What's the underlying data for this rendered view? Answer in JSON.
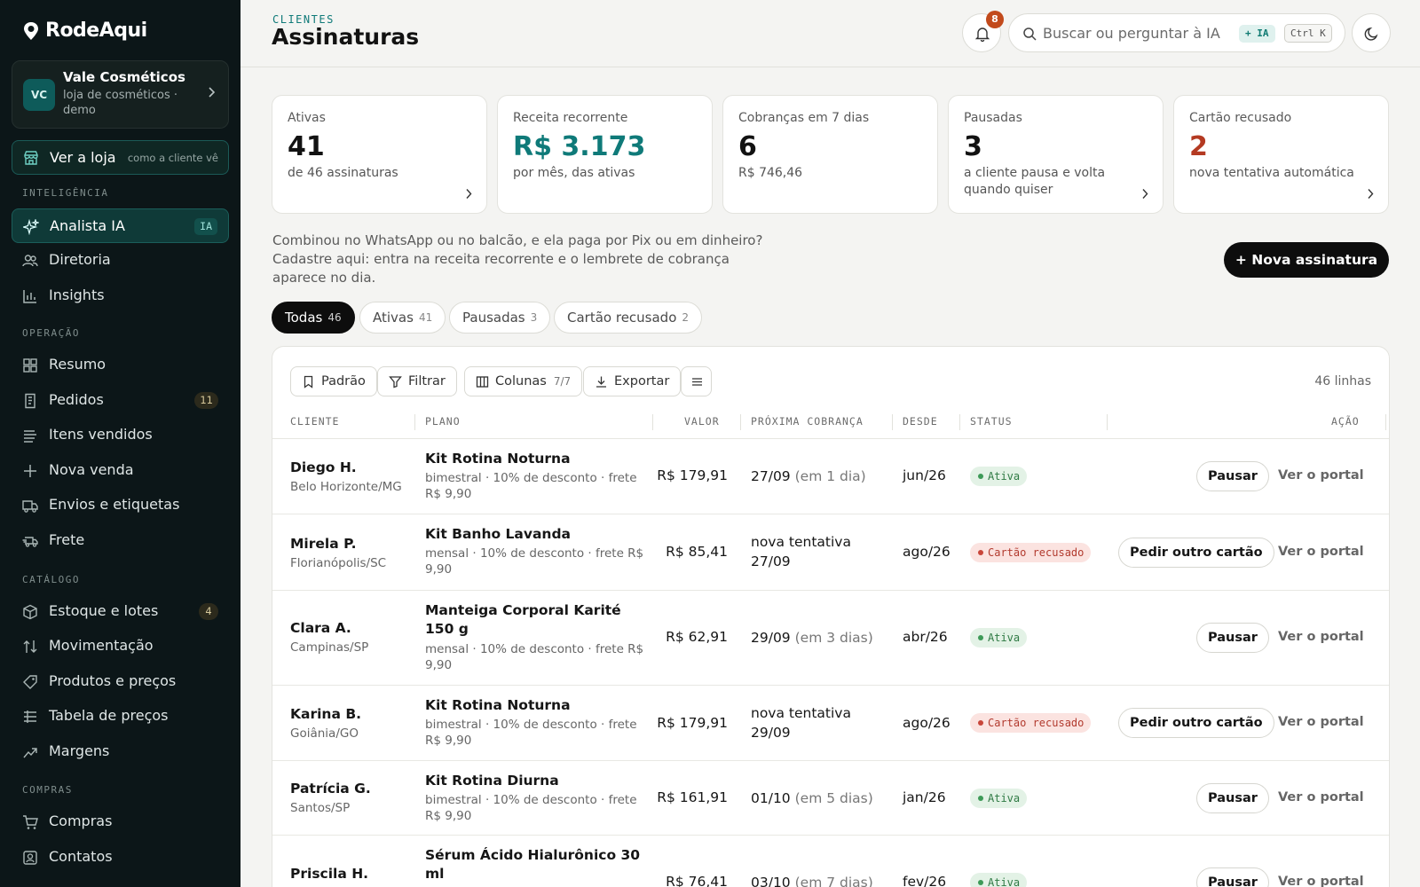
{
  "app": {
    "name": "RodeAqui"
  },
  "store": {
    "initials": "VC",
    "name": "Vale Cosméticos",
    "subtitle": "loja de cosméticos · demo"
  },
  "see_store": {
    "label": "Ver a loja",
    "hint": "como a cliente vê"
  },
  "sidebar": {
    "sections": [
      {
        "label": "INTELIGÊNCIA"
      },
      {
        "label": "OPERAÇÃO"
      },
      {
        "label": "CATÁLOGO"
      },
      {
        "label": "COMPRAS"
      }
    ],
    "items": [
      {
        "label": "Analista IA",
        "badge": "IA",
        "icon": "sparkle-icon"
      },
      {
        "label": "Diretoria",
        "icon": "users-icon"
      },
      {
        "label": "Insights",
        "icon": "bar-chart-icon"
      },
      {
        "label": "Resumo",
        "icon": "grid-icon"
      },
      {
        "label": "Pedidos",
        "badge": "11",
        "icon": "receipt-icon"
      },
      {
        "label": "Itens vendidos",
        "icon": "list-icon"
      },
      {
        "label": "Nova venda",
        "icon": "plus-icon"
      },
      {
        "label": "Envios e etiquetas",
        "icon": "truck-icon"
      },
      {
        "label": "Frete",
        "icon": "delivery-icon"
      },
      {
        "label": "Estoque e lotes",
        "badge": "4",
        "icon": "box-icon"
      },
      {
        "label": "Movimentação",
        "icon": "arrows-updown-icon"
      },
      {
        "label": "Produtos e preços",
        "icon": "tag-icon"
      },
      {
        "label": "Tabela de preços",
        "icon": "table-icon"
      },
      {
        "label": "Margens",
        "icon": "trend-up-icon"
      },
      {
        "label": "Compras",
        "icon": "cart-icon"
      },
      {
        "label": "Contatos",
        "icon": "contact-icon"
      }
    ]
  },
  "header": {
    "breadcrumb": "CLIENTES",
    "title": "Assinaturas",
    "notifications": "8",
    "search_placeholder": "Buscar ou perguntar à IA",
    "ia_chip": "+ IA",
    "shortcut": "Ctrl K"
  },
  "stats": [
    {
      "label": "Ativas",
      "value": "41",
      "sub": "de 46 assinaturas"
    },
    {
      "label": "Receita recorrente",
      "value": "R$ 3.173",
      "sub": "por mês, das ativas"
    },
    {
      "label": "Cobranças em 7 dias",
      "value": "6",
      "sub": "R$ 746,46"
    },
    {
      "label": "Pausadas",
      "value": "3",
      "sub": "a cliente pausa e volta quando quiser"
    },
    {
      "label": "Cartão recusado",
      "value": "2",
      "sub": "nova tentativa automática"
    }
  ],
  "intro": "Combinou no WhatsApp ou no balcão, e ela paga por Pix ou em dinheiro? Cadastre aqui: entra na receita recorrente e o lembrete de cobrança aparece no dia.",
  "new_button": "+ Nova assinatura",
  "tabs": [
    {
      "label": "Todas",
      "count": "46"
    },
    {
      "label": "Ativas",
      "count": "41"
    },
    {
      "label": "Pausadas",
      "count": "3"
    },
    {
      "label": "Cartão recusado",
      "count": "2"
    }
  ],
  "toolbar": {
    "preset": "Padrão",
    "filter": "Filtrar",
    "columns": "Colunas",
    "columns_count": "7/7",
    "export": "Exportar",
    "rows": "46 linhas"
  },
  "columns": [
    "CLIENTE",
    "PLANO",
    "VALOR",
    "PRÓXIMA COBRANÇA",
    "DESDE",
    "STATUS",
    "AÇÃO"
  ],
  "rows": [
    {
      "name": "Diego H.",
      "city": "Belo Horizonte/MG",
      "plan": "Kit Rotina Noturna",
      "plan_desc": "bimestral · 10% de desconto · frete R$ 9,90",
      "value": "R$ 179,91",
      "next": "27/09",
      "next_rel": "(em 1 dia)",
      "since": "jun/26",
      "status": "Ativa",
      "action": "Pausar",
      "portal": "Ver o portal"
    },
    {
      "name": "Mirela P.",
      "city": "Florianópolis/SC",
      "plan": "Kit Banho Lavanda",
      "plan_desc": "mensal · 10% de desconto · frete R$ 9,90",
      "value": "R$ 85,41",
      "next": "nova tentativa 27/09",
      "next_rel": "",
      "since": "ago/26",
      "status": "Cartão recusado",
      "action": "Pedir outro cartão",
      "portal": "Ver o portal"
    },
    {
      "name": "Clara A.",
      "city": "Campinas/SP",
      "plan": "Manteiga Corporal Karité 150 g",
      "plan_desc": "mensal · 10% de desconto · frete R$ 9,90",
      "value": "R$ 62,91",
      "next": "29/09",
      "next_rel": "(em 3 dias)",
      "since": "abr/26",
      "status": "Ativa",
      "action": "Pausar",
      "portal": "Ver o portal"
    },
    {
      "name": "Karina B.",
      "city": "Goiânia/GO",
      "plan": "Kit Rotina Noturna",
      "plan_desc": "bimestral · 10% de desconto · frete R$ 9,90",
      "value": "R$ 179,91",
      "next": "nova tentativa 29/09",
      "next_rel": "",
      "since": "ago/26",
      "status": "Cartão recusado",
      "action": "Pedir outro cartão",
      "portal": "Ver o portal"
    },
    {
      "name": "Patrícia G.",
      "city": "Santos/SP",
      "plan": "Kit Rotina Diurna",
      "plan_desc": "bimestral · 10% de desconto · frete R$ 9,90",
      "value": "R$ 161,91",
      "next": "01/10",
      "next_rel": "(em 5 dias)",
      "since": "jan/26",
      "status": "Ativa",
      "action": "Pausar",
      "portal": "Ver o portal"
    },
    {
      "name": "Priscila H.",
      "city": "",
      "plan": "Sérum Ácido Hialurônico 30 ml",
      "plan_desc": "",
      "value": "R$ 76,41",
      "next": "03/10",
      "next_rel": "(em 7 dias)",
      "since": "fev/26",
      "status": "Ativa",
      "action": "Pausar",
      "portal": "Ver o portal"
    }
  ]
}
